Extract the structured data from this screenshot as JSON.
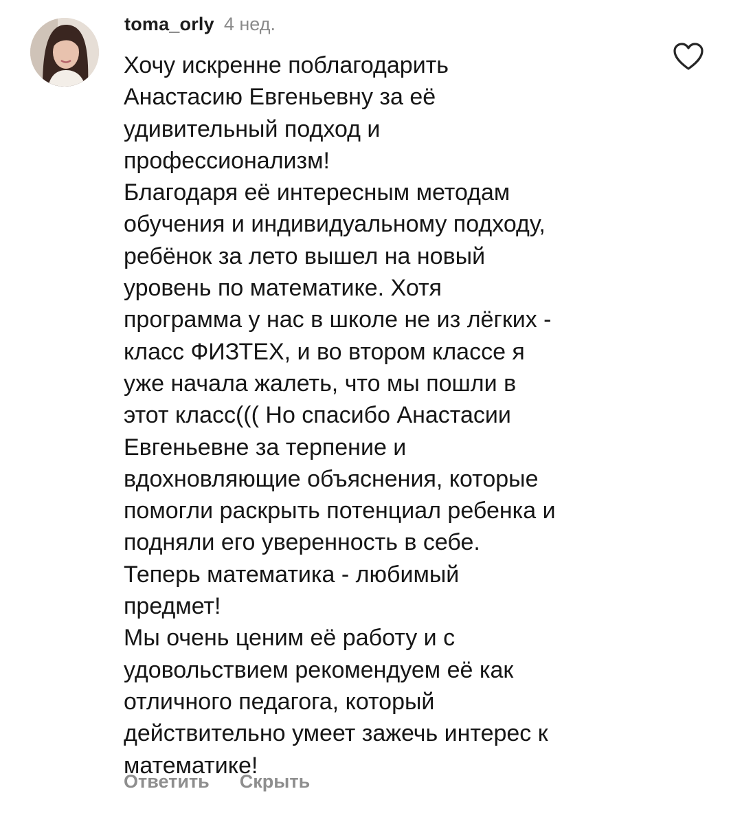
{
  "comment": {
    "username": "toma_orly",
    "time_ago": "4 нед.",
    "avatar": "user-avatar-photo",
    "like_icon": "heart-outline-icon",
    "lines": [
      "Хочу искренне поблагодарить",
      "Анастасию Евгеньевну за её",
      "удивительный подход и",
      "профессионализм!",
      "Благодаря её интересным методам",
      "обучения и индивидуальному подходу,",
      "ребёнок за лето вышел на новый",
      "уровень по математике. Хотя",
      "программа у нас в школе не из лёгких -",
      "класс ФИЗТЕХ, и во втором классе я",
      "уже начала жалеть, что мы пошли в",
      "этот класс((( Но спасибо Анастасии",
      "Евгеньевне за терпение и",
      "вдохновляющие объяснения, которые",
      "помогли раскрыть потенциал ребенка и",
      "подняли его уверенность в себе.",
      "Теперь математика - любимый",
      "предмет!",
      "Мы очень ценим её работу и с",
      "удовольствием рекомендуем её как",
      "отличного педагога, который",
      "действительно умеет зажечь интерес к",
      "математике!"
    ],
    "actions": {
      "reply": "Ответить",
      "hide": "Скрыть"
    }
  },
  "colors": {
    "text": "#161616",
    "muted": "#8a8a8a",
    "action": "#8e8e8e",
    "background": "#ffffff"
  }
}
